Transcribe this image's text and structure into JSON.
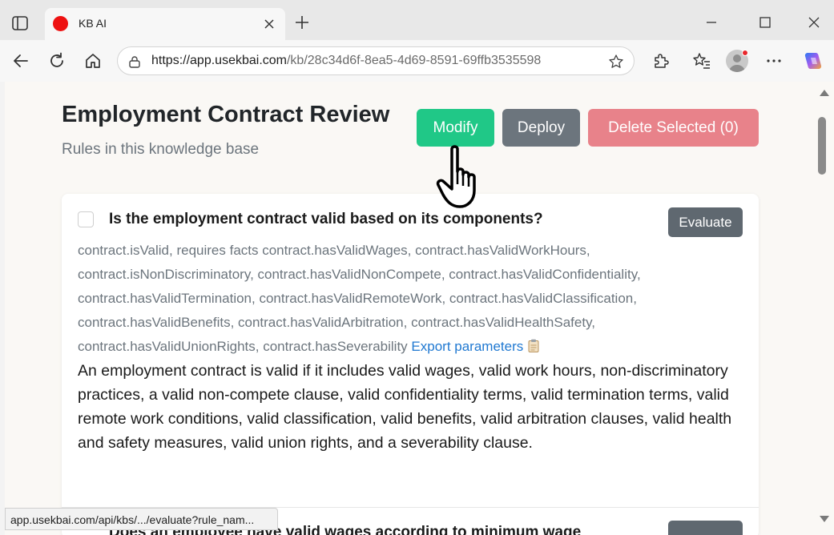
{
  "browser": {
    "tab_title": "KB AI",
    "url_host": "https://app.usekbai.com",
    "url_path": "/kb/28c34d6f-8ea5-4d69-8591-69ffb3535598",
    "status_url": "app.usekbai.com/api/kbs/.../evaluate?rule_nam...",
    "colors": {
      "favicon": "#ee1111"
    }
  },
  "page": {
    "title": "Employment Contract Review",
    "subtitle": "Rules in this knowledge base"
  },
  "actions": {
    "modify_label": "Modify",
    "deploy_label": "Deploy",
    "delete_label": "Delete Selected (0)",
    "colors": {
      "modify": "#20c887",
      "deploy": "#6c757d",
      "delete": "#e8828a"
    }
  },
  "rules": [
    {
      "question": "Is the employment contract valid based on its components?",
      "evaluate_label": "Evaluate",
      "meta": "contract.isValid, requires facts contract.hasValidWages, contract.hasValidWorkHours, contract.isNonDiscriminatory, contract.hasValidNonCompete, contract.hasValidConfidentiality, contract.hasValidTermination, contract.hasValidRemoteWork, contract.hasValidClassification, contract.hasValidBenefits, contract.hasValidArbitration, contract.hasValidHealthSafety, contract.hasValidUnionRights, contract.hasSeverability",
      "export_label": "Export parameters",
      "description": "An employment contract is valid if it includes valid wages, valid work hours, non-discriminatory practices, a valid non-compete clause, valid confidentiality terms, valid termination terms, valid remote work conditions, valid classification, valid benefits, valid arbitration clauses, valid health and safety measures, valid union rights, and a severability clause."
    },
    {
      "question": "Does an employee have valid wages according to minimum wage"
    }
  ]
}
